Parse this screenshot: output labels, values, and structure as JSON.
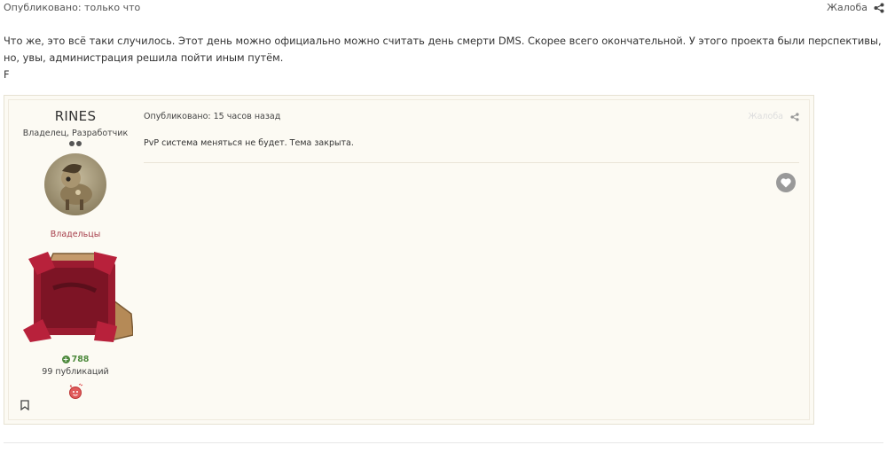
{
  "outer_post": {
    "published": "Опубликовано: только что",
    "report_label": "Жалоба",
    "paragraph": "Что же, это всё таки случилось. Этот день можно официально можно считать день смерти DMS. Скорее всего окончательной. У этого проекта были перспективы, но, увы, администрация решила пойти иным путём.",
    "second_line": "F"
  },
  "quoted_post": {
    "author": {
      "name": "RINES",
      "title": "Владелец, Разработчик",
      "group": "Владельцы",
      "reputation": "788",
      "post_count": "99 публикаций"
    },
    "published": "Опубликовано: 15 часов назад",
    "report_label": "Жалоба",
    "text": "PvP система меняться не будет. Тема закрыта."
  },
  "colors": {
    "quote_bg": "#fcfaf3",
    "group_color": "#a63d4a",
    "reputation_color": "#4e8a3d",
    "badge_color": "#9b1b30"
  },
  "icons": {
    "share": "share-icon",
    "bookmark": "bookmark-icon",
    "like": "heart-icon"
  }
}
